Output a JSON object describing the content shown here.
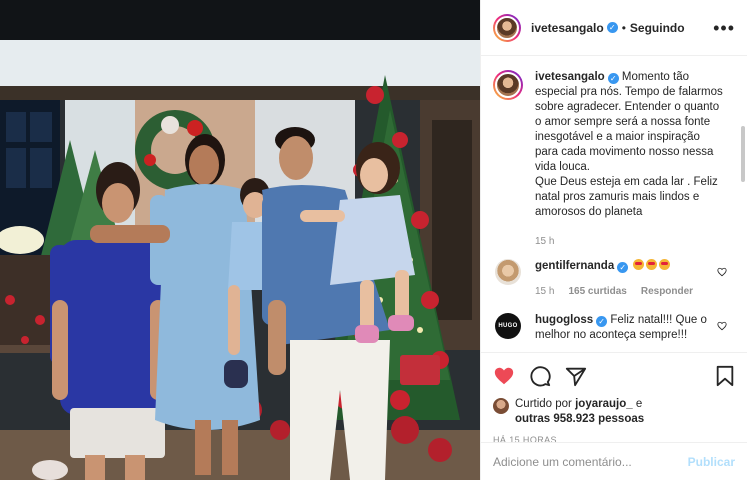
{
  "post": {
    "username": "ivetesangalo",
    "separator": "•",
    "follow_status": "Seguindo",
    "more_label": "•••"
  },
  "caption": {
    "username": "ivetesangalo",
    "text": "Momento tão especial pra nós. Tempo de falarmos sobre agradecer. Entender o quanto o amor sempre será a nossa fonte inesgotável e a maior inspiração para cada movimento nosso nessa vida louca.",
    "text2": "Que Deus esteja em cada lar . Feliz natal pros zamuris mais lindos e amorosos do planeta",
    "time": "15 h"
  },
  "comments": [
    {
      "username": "gentilfernanda",
      "text": "",
      "time": "15 h",
      "likes": "165 curtidas",
      "reply": "Responder"
    },
    {
      "username": "hugogloss",
      "avatar_text": "HUGO GLOSS",
      "text": "Feliz natal!!! Que o melhor no aconteça sempre!!!"
    }
  ],
  "likes": {
    "prefix": "Curtido por",
    "user": "joyaraujo_",
    "conj": "e",
    "others": "outras 958.923 pessoas"
  },
  "timestamp": "HÁ 15 HORAS",
  "add_comment": {
    "placeholder": "Adicione um comentário...",
    "publish": "Publicar"
  },
  "colors": {
    "like_red": "#ed4956",
    "verified_blue": "#3897f0",
    "publish_disabled": "#b2dffc"
  },
  "icons": [
    "like-heart-icon",
    "comment-icon",
    "share-icon",
    "save-icon",
    "verified-icon",
    "more-icon"
  ]
}
